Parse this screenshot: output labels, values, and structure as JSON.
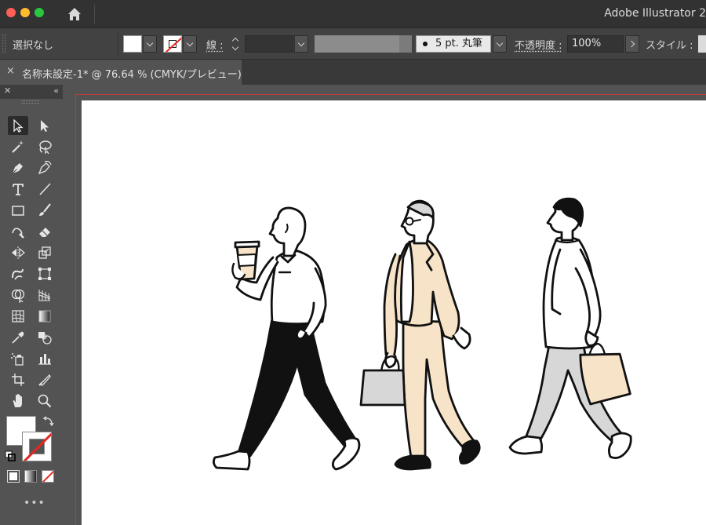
{
  "titlebar": {
    "app_title": "Adobe Illustrator 2"
  },
  "controlbar": {
    "selection_label": "選択なし",
    "stroke_label": "線 :",
    "brush_label": "5 pt. 丸筆",
    "opacity_label": "不透明度 :",
    "opacity_value": "100%",
    "style_label": "スタイル :"
  },
  "document": {
    "tab_title": "名称未設定-1* @ 76.64 % (CMYK/プレビュー)",
    "close_glyph": "×"
  },
  "toolbar": {
    "close_glyph": "✕",
    "collapse_glyph": "«",
    "more_glyph": "•••"
  },
  "colors": {
    "accent_red": "#e3281f",
    "bleed_guide": "#c23a3a",
    "beige": "#f6e3c8",
    "light_gray": "#d7d7d7",
    "ink": "#111111"
  },
  "icons": [
    "home-icon",
    "selection-tool-icon",
    "direct-selection-tool-icon",
    "magic-wand-icon",
    "lasso-icon",
    "pen-icon",
    "curvature-icon",
    "type-icon",
    "line-icon",
    "rectangle-icon",
    "paintbrush-icon",
    "shaper-icon",
    "eraser-icon",
    "reflect-icon",
    "scale-icon",
    "warp-icon",
    "free-transform-icon",
    "shape-builder-icon",
    "perspective-grid-icon",
    "mesh-icon",
    "gradient-icon",
    "eyedropper-icon",
    "blend-icon",
    "symbol-sprayer-icon",
    "column-graph-icon",
    "artboard-icon",
    "slice-icon",
    "hand-icon",
    "zoom-icon"
  ]
}
